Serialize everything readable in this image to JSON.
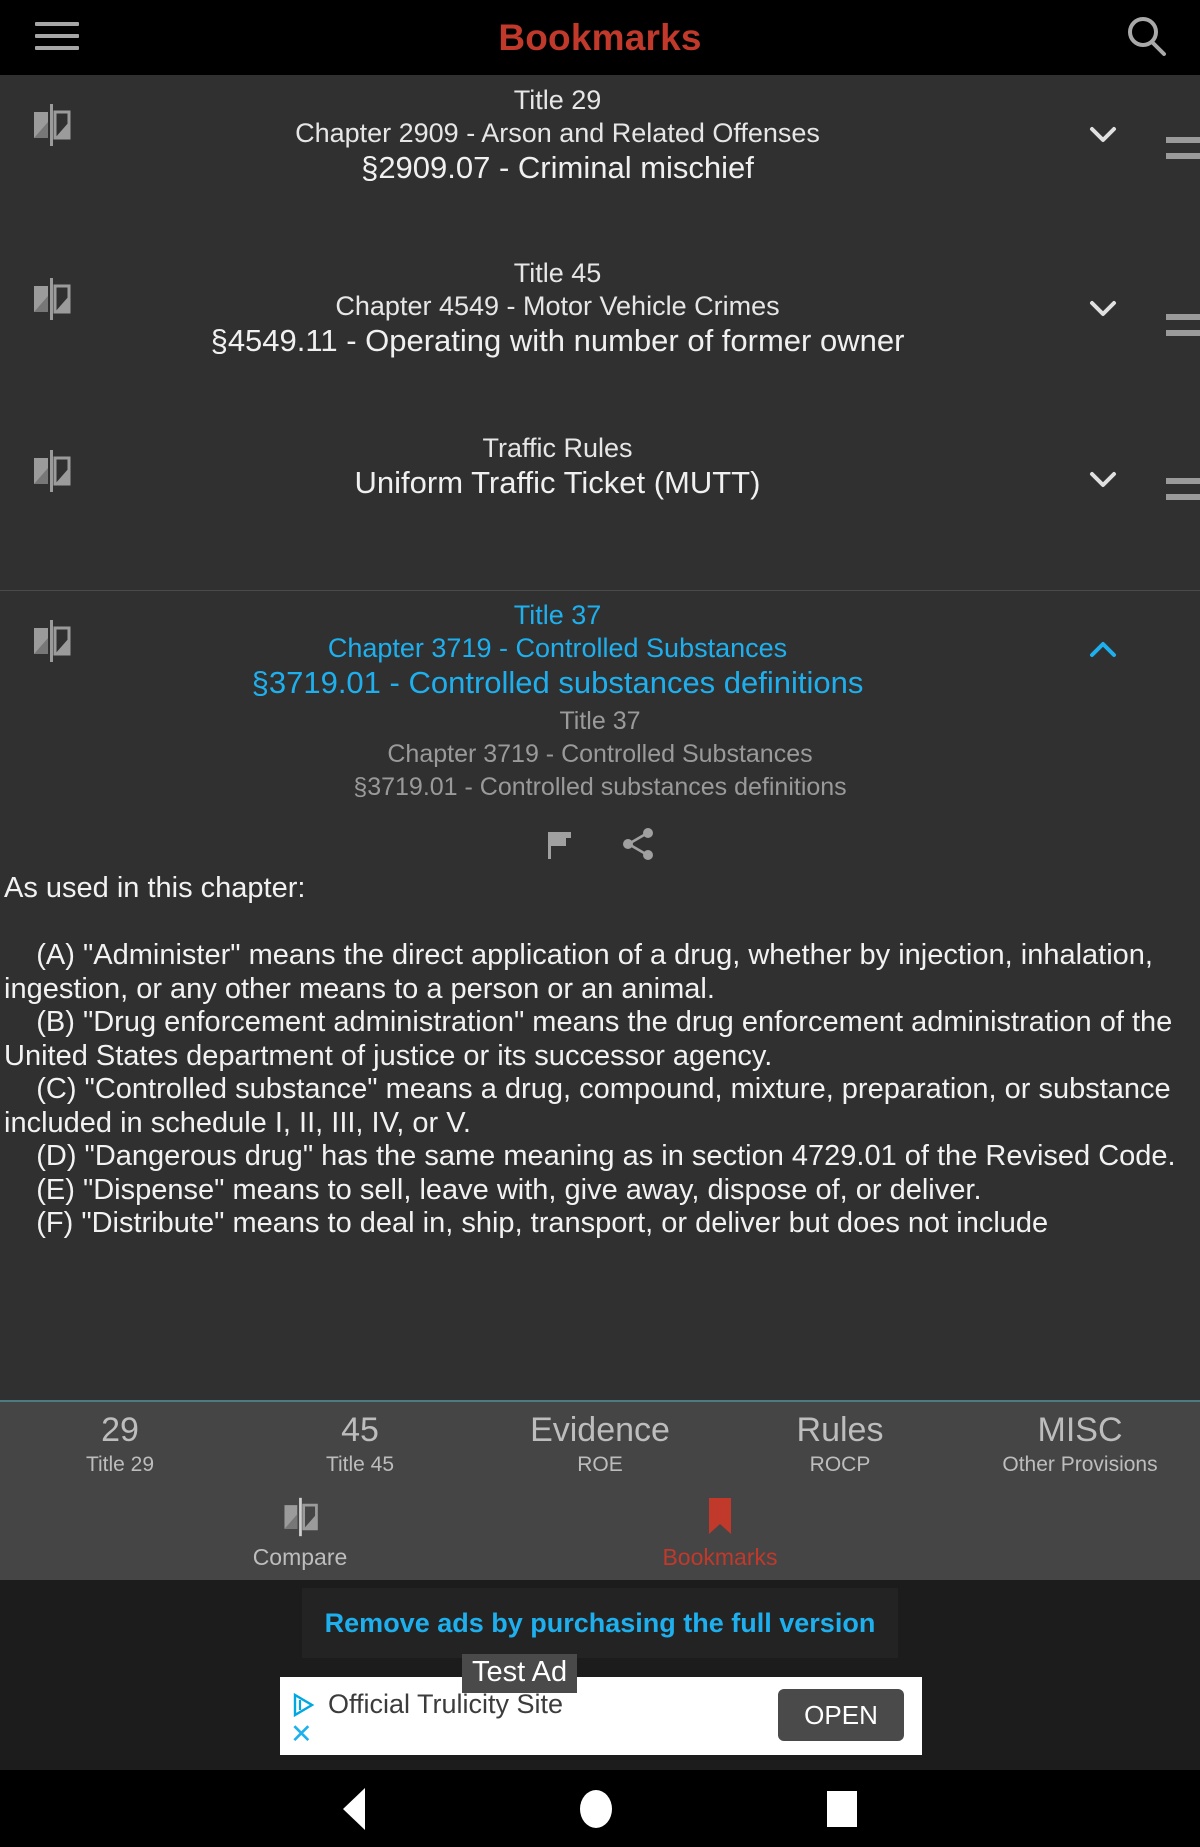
{
  "appbar": {
    "title": "Bookmarks",
    "menu_icon": "hamburger-menu-icon",
    "search_icon": "search-icon",
    "title_color": "#c0392b"
  },
  "bookmarks": [
    {
      "line1": "Title 29",
      "line2": "Chapter 2909 - Arson and Related Offenses",
      "line3": "§2909.07 - Criminal mischief",
      "expanded": false,
      "chevron": "chevron-down-icon"
    },
    {
      "line1": "Title 45",
      "line2": "Chapter 4549 - Motor Vehicle Crimes",
      "line3": "§4549.11 - Operating with number of former owner",
      "expanded": false,
      "chevron": "chevron-down-icon"
    },
    {
      "line1": "Traffic Rules",
      "line2": "Uniform Traffic Ticket (MUTT)",
      "line3": "",
      "expanded": false,
      "chevron": "chevron-down-icon"
    }
  ],
  "expanded_item": {
    "line1": "Title 37",
    "line2": "Chapter 3719 - Controlled Substances",
    "line3": "§3719.01 - Controlled substances definitions",
    "sub_line1": "Title 37",
    "sub_line2": "Chapter 3719 - Controlled Substances",
    "sub_line3": "§3719.01 - Controlled substances definitions",
    "chevron": "chevron-up-icon",
    "accent_color": "#1eb0ee",
    "actions": [
      {
        "name": "flag-icon",
        "label": "Flag"
      },
      {
        "name": "share-icon",
        "label": "Share"
      }
    ],
    "body": "As used in this chapter:\n\n    (A) \"Administer\" means the direct application of a drug, whether by injection, inhalation, ingestion, or any other means to a person or an animal.\n    (B) \"Drug enforcement administration\" means the drug enforcement administration of the United States department of justice or its successor agency.\n    (C) \"Controlled substance\" means a drug, compound, mixture, preparation, or substance included in schedule I, II, III, IV, or V.\n    (D) \"Dangerous drug\" has the same meaning as in section 4729.01 of the Revised Code.\n    (E) \"Dispense\" means to sell, leave with, give away, dispose of, or deliver.\n    (F) \"Distribute\" means to deal in, ship, transport, or deliver but does not include"
  },
  "bottom_nav": {
    "tabs": [
      {
        "big": "29",
        "small": "Title 29"
      },
      {
        "big": "45",
        "small": "Title 45"
      },
      {
        "big": "Evidence",
        "small": "ROE"
      },
      {
        "big": "Rules",
        "small": "ROCP"
      },
      {
        "big": "MISC",
        "small": "Other Provisions"
      }
    ],
    "second_row": [
      {
        "label": "Compare",
        "icon": "compare-icon",
        "active": false
      },
      {
        "label": "Bookmarks",
        "icon": "bookmark-icon",
        "active": true
      }
    ],
    "active_color": "#c0392b"
  },
  "promo": {
    "label": "Remove ads by purchasing the full version",
    "color": "#1eb0ee"
  },
  "ad": {
    "test_badge": "Test Ad",
    "title": "Official Trulicity Site",
    "open_label": "OPEN",
    "close_label": "✕",
    "adchoices_icon": "adchoices-icon"
  },
  "system_nav": {
    "back": "back-button",
    "home": "home-button",
    "recents": "recents-button"
  }
}
